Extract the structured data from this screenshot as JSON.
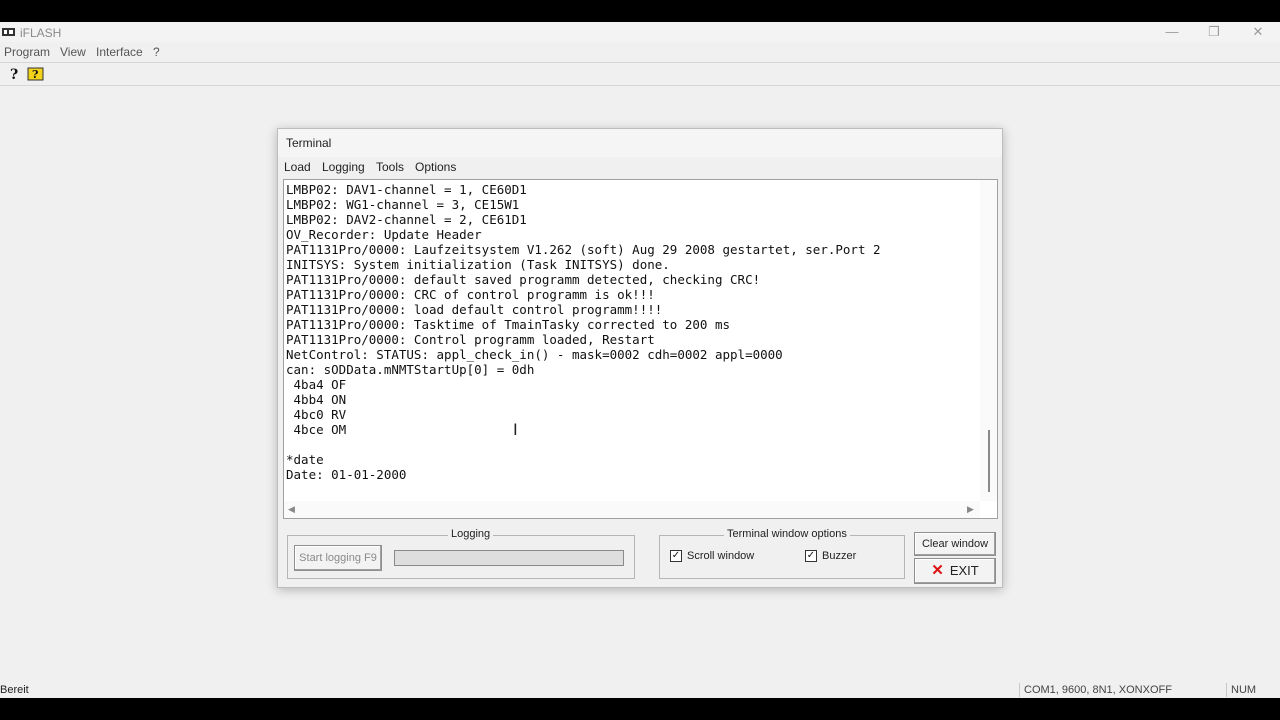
{
  "app": {
    "title": "iFLASH",
    "menu": [
      "Program",
      "View",
      "Interface",
      "?"
    ],
    "toolbar": [
      {
        "name": "help-icon",
        "glyph": "?"
      },
      {
        "name": "context-help-icon",
        "glyph": "?"
      }
    ]
  },
  "window_controls": {
    "minimize": "—",
    "restore": "❐",
    "close": "✕"
  },
  "terminal_dialog": {
    "title": "Terminal",
    "menu": [
      "Load",
      "Logging",
      "Tools",
      "Options"
    ],
    "lines": [
      "LMBP02: DAV1-channel = 1, CE60D1",
      "LMBP02: WG1-channel = 3, CE15W1",
      "LMBP02: DAV2-channel = 2, CE61D1",
      "OV_Recorder: Update Header",
      "PAT1131Pro/0000: Laufzeitsystem V1.262 (soft) Aug 29 2008 gestartet, ser.Port 2",
      "INITSYS: System initialization (Task INITSYS) done.",
      "PAT1131Pro/0000: default saved programm detected, checking CRC!",
      "PAT1131Pro/0000: CRC of control programm is ok!!!",
      "PAT1131Pro/0000: load default control programm!!!!",
      "PAT1131Pro/0000: Tasktime of TmainTasky corrected to 200 ms",
      "PAT1131Pro/0000: Control programm loaded, Restart",
      "NetControl: STATUS: appl_check_in() - mask=0002 cdh=0002 appl=0000",
      "can: sODData.mNMTStartUp[0] = 0dh",
      " 4ba4 OF",
      " 4bb4 ON",
      " 4bc0 RV",
      " 4bce OM",
      "",
      "*date",
      "Date: 01-01-2000"
    ],
    "logging": {
      "group_label": "Logging",
      "start_button": "Start logging F9",
      "progress": 0
    },
    "options": {
      "group_label": "Terminal window options",
      "scroll_window": {
        "label": "Scroll window",
        "checked": true
      },
      "buzzer": {
        "label": "Buzzer",
        "checked": true
      }
    },
    "clear_button": "Clear window",
    "exit_button": "EXIT"
  },
  "status": {
    "text": "Bereit",
    "port": "COM1, 9600, 8N1, XONXOFF",
    "num": "NUM"
  }
}
